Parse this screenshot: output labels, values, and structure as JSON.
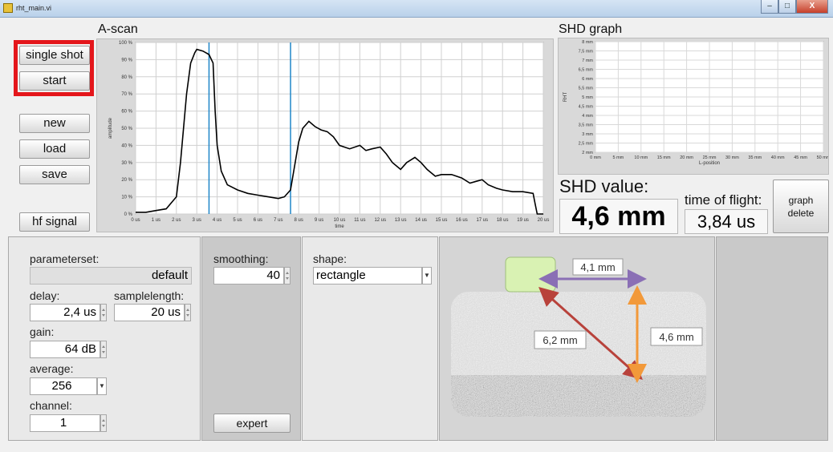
{
  "window": {
    "title": "rht_main.vi",
    "min_label": "–",
    "max_label": "□",
    "close_label": "X"
  },
  "buttons": {
    "single_shot": "single shot",
    "start": "start",
    "new": "new",
    "load": "load",
    "save": "save",
    "hf_signal": "hf signal",
    "expert": "expert",
    "graph_delete": [
      "graph",
      "delete"
    ]
  },
  "ascan": {
    "title": "A-scan",
    "ylabel": "amplitude",
    "xlabel": "time",
    "y_ticks": [
      "0 %",
      "10 %",
      "20 %",
      "30 %",
      "40 %",
      "50 %",
      "60 %",
      "70 %",
      "80 %",
      "90 %",
      "100 %"
    ],
    "x_ticks": [
      "0 us",
      "1 us",
      "2 us",
      "3 us",
      "4 us",
      "5 us",
      "6 us",
      "7 us",
      "8 us",
      "9 us",
      "10 us",
      "11 us",
      "12 us",
      "13 us",
      "14 us",
      "15 us",
      "16 us",
      "17 us",
      "18 us",
      "19 us",
      "20 us"
    ]
  },
  "shd_graph": {
    "title": "SHD graph",
    "ylabel": "RHT",
    "xlabel": "L-position",
    "y_ticks": [
      "2 mm",
      "2,5 mm",
      "3 mm",
      "3,5 mm",
      "4 mm",
      "4,5 mm",
      "5 mm",
      "5,5 mm",
      "6 mm",
      "6,5 mm",
      "7 mm",
      "7,5 mm",
      "8 mm"
    ],
    "x_ticks": [
      "0 mm",
      "5 mm",
      "10 mm",
      "15 mm",
      "20 mm",
      "25 mm",
      "30 mm",
      "35 mm",
      "40 mm",
      "45 mm",
      "50 mm"
    ]
  },
  "chart_data": [
    {
      "type": "line",
      "title": "A-scan",
      "xlabel": "time",
      "ylabel": "amplitude",
      "xlim": [
        0,
        20
      ],
      "ylim": [
        0,
        100
      ],
      "grid": true,
      "x_unit": "us",
      "y_unit": "%",
      "series": [
        {
          "x": [
            0,
            0.5,
            1,
            1.5,
            2,
            2.2,
            2.5,
            2.7,
            2.9,
            3.0,
            3.3,
            3.6,
            3.8,
            3.9,
            4.0,
            4.2,
            4.5,
            5,
            5.5,
            6,
            6.5,
            7,
            7.3,
            7.6,
            7.8,
            8.0,
            8.2,
            8.5,
            8.8,
            9.1,
            9.4,
            9.7,
            10.0,
            10.5,
            11,
            11.3,
            11.6,
            12,
            12.3,
            12.6,
            13,
            13.3,
            13.7,
            14,
            14.3,
            14.7,
            15,
            15.5,
            16,
            16.4,
            16.7,
            17,
            17.3,
            17.7,
            18,
            18.5,
            19,
            19.5,
            19.6,
            19.7,
            20
          ],
          "y": [
            1,
            1,
            2,
            3,
            10,
            30,
            70,
            88,
            94,
            96,
            95,
            93,
            88,
            60,
            40,
            25,
            17,
            14,
            12,
            11,
            10,
            9,
            10,
            14,
            28,
            42,
            50,
            54,
            51,
            49,
            48,
            45,
            40,
            38,
            40,
            37,
            38,
            39,
            35,
            30,
            26,
            30,
            33,
            30,
            26,
            22,
            23,
            23,
            21,
            18,
            19,
            20,
            17,
            15,
            14,
            13,
            13,
            12,
            6,
            0,
            0
          ]
        }
      ],
      "cursors_x": [
        3.6,
        7.6
      ]
    },
    {
      "type": "scatter",
      "title": "SHD graph",
      "xlabel": "L-position",
      "ylabel": "RHT",
      "xlim": [
        0,
        50
      ],
      "ylim": [
        2,
        8
      ],
      "grid": true,
      "series": []
    }
  ],
  "shd": {
    "label": "SHD value:",
    "value": "4,6 mm",
    "tof_label": "time of flight:",
    "tof_value": "3,84 us"
  },
  "params": {
    "parameterset_label": "parameterset:",
    "parameterset_value": "default",
    "delay_label": "delay:",
    "delay_value": "2,4 us",
    "samplelength_label": "samplelength:",
    "samplelength_value": "20 us",
    "gain_label": "gain:",
    "gain_value": "64 dB",
    "average_label": "average:",
    "average_value": "256",
    "channel_label": "channel:",
    "channel_value": "1"
  },
  "smoothing": {
    "label": "smoothing:",
    "value": "40"
  },
  "shape": {
    "label": "shape:",
    "value": "rectangle"
  },
  "diagram": {
    "horizontal": "4,1 mm",
    "diagonal": "6,2 mm",
    "vertical": "4,6 mm",
    "colors": {
      "horizontal": "#8a6fb5",
      "diagonal": "#b8423b",
      "vertical": "#f2993a",
      "sensor": "#d9f2b3"
    }
  }
}
